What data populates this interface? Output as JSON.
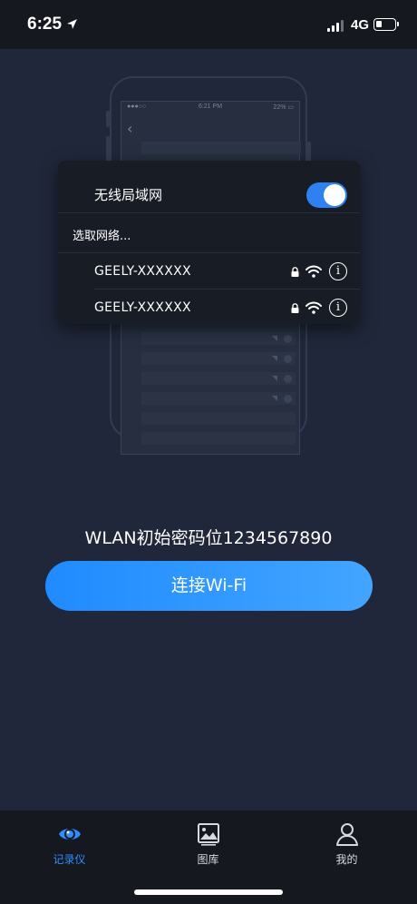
{
  "status_bar": {
    "time": "6:25",
    "network": "4G",
    "signal_bars": 3,
    "battery_level": 0.25
  },
  "illustration": {
    "ghost_phone": {
      "time": "6:21 PM",
      "carrier": "●●●○○ ",
      "battery": "22% ▭"
    },
    "popup": {
      "wlan_label": "无线局域网",
      "wlan_enabled": true,
      "choose_network_label": "选取网络...",
      "networks": [
        {
          "name": "GEELY-XXXXXX"
        },
        {
          "name": "GEELY-XXXXXX"
        }
      ]
    }
  },
  "main": {
    "password_hint": "WLAN初始密码位1234567890",
    "connect_button": "连接Wi-Fi"
  },
  "tab_bar": {
    "tabs": [
      {
        "label": "记录仪",
        "icon": "eye-icon",
        "active": true
      },
      {
        "label": "图库",
        "icon": "gallery-icon",
        "active": false
      },
      {
        "label": "我的",
        "icon": "user-icon",
        "active": false
      }
    ]
  },
  "colors": {
    "background": "#20273a",
    "accent": "#2f8cff",
    "bars": "#15181f"
  }
}
